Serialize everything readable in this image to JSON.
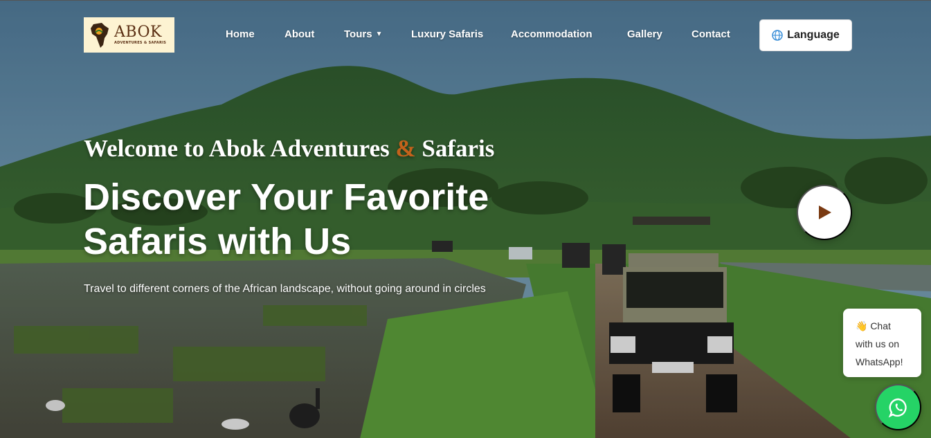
{
  "logo": {
    "title": "ABOK",
    "subtitle": "ADVENTURES & SAFARIS"
  },
  "nav": {
    "items": [
      {
        "label": "Home"
      },
      {
        "label": "About"
      },
      {
        "label": "Tours",
        "has_dropdown": true
      },
      {
        "label": "Luxury Safaris"
      },
      {
        "label": "Accommodation"
      },
      {
        "label": "Gallery"
      },
      {
        "label": "Contact"
      }
    ],
    "language_label": "Language",
    "language_icon": "globe-icon"
  },
  "hero": {
    "welcome_part1": "Welcome to Abok Adventures",
    "welcome_amp": "&",
    "welcome_part2": "Safaris",
    "headline_line1": "Discover Your Favorite",
    "headline_line2": "Safaris with Us",
    "subline": "Travel to different corners of the African landscape, without going around in circles",
    "play_icon": "play-icon"
  },
  "whatsapp": {
    "bubble_line1": "👋 Chat",
    "bubble_line2": "with us on",
    "bubble_line3": "WhatsApp!",
    "icon": "whatsapp-icon"
  },
  "colors": {
    "accent": "#c4621b",
    "logo_brown": "#5a2e12",
    "logo_bg": "#fdf3d2",
    "whatsapp_green": "#25d366"
  }
}
